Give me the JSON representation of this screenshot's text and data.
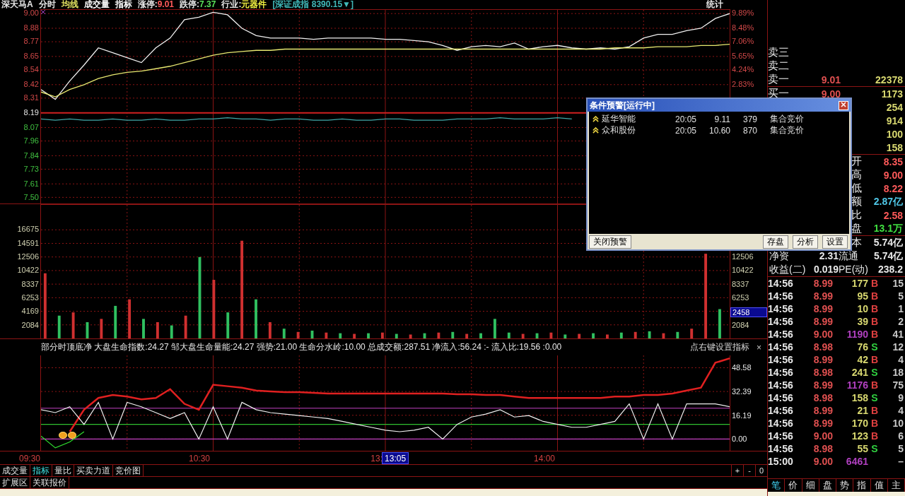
{
  "header": {
    "stock": "深天马A",
    "items": [
      {
        "text": "分时",
        "color": "#e8e8e8"
      },
      {
        "text": "均线",
        "color": "#e0e060"
      },
      {
        "text": "成交量",
        "color": "#ffffff"
      },
      {
        "text": "指标",
        "color": "#ffffff"
      }
    ],
    "fields": [
      {
        "label": "涨停:",
        "value": "9.01",
        "color": "#ff5a5a"
      },
      {
        "label": "跌停:",
        "value": "7.37",
        "color": "#5ae05a"
      },
      {
        "label": "行业:",
        "value": "元器件",
        "color": "#f0f040"
      }
    ],
    "index": "[深证成指 8390.15▼]",
    "stats_button": "统计"
  },
  "price_chart": {
    "right_labels": [
      "9.89%",
      "8.48%",
      "7.06%",
      "5.65%",
      "4.24%",
      "2.83%"
    ],
    "chart_data": {
      "type": "line",
      "ylim": [
        7.45,
        9.03
      ],
      "grid": true,
      "yticks": [
        {
          "value": 9,
          "label": "9.00"
        },
        {
          "value": 8.88,
          "label": "8.88"
        },
        {
          "value": 8.77,
          "label": "8.77"
        },
        {
          "value": 8.65,
          "label": "8.65"
        },
        {
          "value": 8.54,
          "label": "8.54"
        },
        {
          "value": 8.42,
          "label": "8.42"
        },
        {
          "value": 8.31,
          "label": "8.31"
        },
        {
          "value": 8.19,
          "label": "8.19"
        },
        {
          "value": 8.07,
          "label": "8.07"
        },
        {
          "value": 7.96,
          "label": "7.96"
        },
        {
          "value": 7.84,
          "label": "7.84"
        },
        {
          "value": 7.73,
          "label": "7.73"
        },
        {
          "value": 7.61,
          "label": "7.61"
        },
        {
          "value": 7.5,
          "label": "7.50"
        }
      ],
      "series": [
        {
          "color": "#f0f0f0",
          "values": [
            8.38,
            8.3,
            8.45,
            8.58,
            8.72,
            8.68,
            8.64,
            8.6,
            8.72,
            8.8,
            8.95,
            8.97,
            9.01,
            8.99,
            8.88,
            8.82,
            8.8,
            8.8,
            8.8,
            8.79,
            8.8,
            8.8,
            8.8,
            8.8,
            8.79,
            8.79,
            8.78,
            8.77,
            8.74,
            8.7,
            8.73,
            8.74,
            8.73,
            8.76,
            8.71,
            8.73,
            8.74,
            8.72,
            8.71,
            8.72,
            8.71,
            8.73,
            8.8,
            8.83,
            8.83,
            8.86,
            8.88,
            8.96,
            9.0
          ]
        },
        {
          "color": "#e8e870",
          "values": [
            8.36,
            8.32,
            8.38,
            8.42,
            8.47,
            8.5,
            8.52,
            8.53,
            8.55,
            8.57,
            8.6,
            8.63,
            8.66,
            8.68,
            8.69,
            8.7,
            8.7,
            8.71,
            8.71,
            8.71,
            8.71,
            8.71,
            8.71,
            8.71,
            8.71,
            8.71,
            8.71,
            8.71,
            8.71,
            8.71,
            8.71,
            8.71,
            8.71,
            8.71,
            8.71,
            8.71,
            8.71,
            8.71,
            8.71,
            8.71,
            8.72,
            8.72,
            8.72,
            8.73,
            8.73,
            8.73,
            8.74,
            8.74,
            8.75
          ]
        },
        {
          "color": "#40a8a8",
          "values": [
            8.14,
            8.13,
            8.14,
            8.13,
            8.13,
            8.14,
            8.13,
            8.13,
            8.14,
            8.13,
            8.13,
            8.14,
            8.14,
            8.15,
            8.14,
            8.14,
            8.13,
            8.14,
            8.14,
            8.13,
            8.13,
            8.14,
            8.13,
            8.13,
            8.14,
            8.14,
            8.13,
            8.13,
            8.13,
            8.14,
            8.14,
            8.14,
            8.15,
            8.14,
            8.14,
            8.14,
            8.15,
            8.14,
            null,
            null,
            null,
            null,
            null,
            null,
            null,
            null,
            null,
            null,
            null
          ]
        },
        {
          "color": "#d02020",
          "values": [
            8.19,
            8.19,
            8.19,
            8.19,
            8.19,
            8.19,
            8.19,
            8.19,
            8.19,
            8.19,
            8.19,
            8.19,
            8.19,
            8.19,
            8.19,
            8.19,
            8.19,
            8.19,
            8.19,
            8.19,
            8.19,
            8.19,
            8.19,
            8.19,
            8.19,
            8.19,
            8.19,
            8.19,
            8.19,
            8.19,
            8.19,
            8.19,
            8.19,
            8.19,
            8.19,
            8.19,
            8.19,
            8.19,
            8.19,
            null,
            null,
            null,
            null,
            null,
            null,
            null,
            null,
            null,
            null
          ]
        }
      ]
    }
  },
  "volume_chart": {
    "right_labels": [
      "12506",
      "10422",
      "8337",
      "6253",
      "2084"
    ],
    "cursor_value": "2458",
    "chart_data": {
      "type": "bar",
      "ylim": [
        0,
        20500
      ],
      "grid": true,
      "yticks": [
        16675,
        14591,
        12506,
        10422,
        8337,
        6253,
        4169,
        2084
      ],
      "series": [
        {
          "color": "#d03030",
          "values": [
            10000,
            null,
            4000,
            null,
            3000,
            null,
            6000,
            null,
            2500,
            null,
            3500,
            null,
            9000,
            null,
            15000,
            null,
            2500,
            null,
            1000,
            null,
            900,
            null,
            700,
            null,
            900,
            null,
            600,
            null,
            900,
            null,
            700,
            null,
            null,
            null,
            700,
            null,
            900,
            null,
            700,
            null,
            600,
            null,
            1000,
            null,
            800,
            null,
            1500,
            13000,
            null
          ]
        },
        {
          "color": "#30c060",
          "values": [
            null,
            3500,
            null,
            2500,
            null,
            5000,
            null,
            3000,
            null,
            2000,
            null,
            12500,
            null,
            4000,
            null,
            6000,
            null,
            1500,
            null,
            1200,
            null,
            800,
            null,
            800,
            null,
            700,
            null,
            800,
            null,
            1000,
            null,
            800,
            3000,
            900,
            null,
            800,
            null,
            600,
            null,
            800,
            null,
            900,
            null,
            1100,
            null,
            1000,
            null,
            null,
            4500
          ]
        }
      ]
    }
  },
  "indicator": {
    "legend": "部分时顶底净  大盘生命指数:24.27  邹大盘生命量能:24.27  强势:21.00  生命分水岭:10.00  总成交额:287.51  净流入:56.24  :-  流入比:19.56  :0.00",
    "hint": "点右键设置指标",
    "close": "×",
    "chart_data": {
      "type": "line",
      "ylim": [
        -8,
        57
      ],
      "grid": true,
      "yticks": [
        {
          "value": 48.58,
          "label": "48.58"
        },
        {
          "value": 32.39,
          "label": "32.39"
        },
        {
          "value": 16.19,
          "label": "16.19"
        },
        {
          "value": 0,
          "label": "0.00"
        }
      ],
      "series": [
        {
          "color": "#c040c0",
          "values": [
            21,
            21,
            21,
            21,
            21,
            21,
            21,
            21,
            21,
            21,
            21,
            21,
            21,
            21,
            21,
            21,
            21,
            21,
            21,
            21,
            21,
            21,
            21,
            21,
            21,
            21,
            21,
            21,
            21,
            21,
            21,
            21,
            21,
            21,
            21,
            21,
            21,
            21,
            21,
            21,
            21,
            21,
            21,
            21,
            21,
            21,
            21,
            21,
            21
          ]
        },
        {
          "color": "#30c030",
          "values": [
            10,
            10,
            10,
            10,
            10,
            10,
            10,
            10,
            10,
            10,
            10,
            10,
            10,
            10,
            10,
            10,
            10,
            10,
            10,
            10,
            10,
            10,
            10,
            10,
            10,
            10,
            10,
            10,
            10,
            10,
            10,
            10,
            10,
            10,
            10,
            10,
            10,
            10,
            10,
            10,
            10,
            10,
            10,
            10,
            10,
            10,
            10,
            10,
            10
          ]
        },
        {
          "color": "#c040c0",
          "values": [
            0,
            0,
            0,
            0,
            0,
            0,
            0,
            0,
            0,
            0,
            0,
            0,
            0,
            0,
            0,
            0,
            0,
            0,
            0,
            0,
            0,
            0,
            0,
            0,
            0,
            0,
            0,
            0,
            0,
            0,
            0,
            0,
            0,
            0,
            0,
            0,
            0,
            0,
            0,
            0,
            0,
            0,
            0,
            0,
            0,
            0,
            0,
            0,
            0
          ]
        },
        {
          "color": "#e02020",
          "values": [
            null,
            null,
            5,
            20,
            28,
            30,
            29,
            27,
            28,
            34,
            24,
            20,
            37,
            36,
            35,
            33,
            32.5,
            32,
            32,
            31.5,
            31,
            31,
            31,
            31,
            31,
            31,
            31,
            31,
            31,
            30.5,
            30.5,
            30,
            30,
            29,
            28,
            28,
            28,
            28,
            28,
            28,
            29,
            29,
            30,
            30,
            31,
            33,
            35,
            52,
            55
          ]
        },
        {
          "color": "#30e030",
          "values": [
            2,
            -6,
            -2,
            5,
            null,
            null,
            null,
            null,
            null,
            null,
            null,
            null,
            null,
            null,
            null,
            null,
            null,
            null,
            null,
            null,
            null,
            null,
            null,
            null,
            null,
            null,
            null,
            null,
            null,
            null,
            null,
            null,
            null,
            null,
            null,
            null,
            null,
            null,
            null,
            null,
            null,
            null,
            null,
            null,
            null,
            null,
            null,
            null,
            null
          ]
        },
        {
          "color": "#f0f0f0",
          "values": [
            20,
            18,
            22,
            10,
            25,
            0,
            25,
            22,
            18,
            14,
            18,
            0,
            22,
            0,
            25,
            20,
            18,
            17,
            16,
            15,
            14,
            12,
            10,
            8,
            6,
            5,
            6,
            8,
            0,
            10,
            15,
            17,
            20,
            15,
            16,
            12,
            10,
            8,
            8,
            10,
            12,
            24,
            0,
            24,
            0,
            24,
            24,
            24,
            22
          ]
        }
      ]
    }
  },
  "time_axis": {
    "labels": [
      "09:30",
      "10:30",
      "13:",
      "14:00"
    ],
    "cursor": "13:05"
  },
  "bottom_tabs": [
    {
      "label": "成交量",
      "selected": false
    },
    {
      "label": "指标",
      "selected": true
    },
    {
      "label": "量比",
      "selected": false
    },
    {
      "label": "买卖力道",
      "selected": false
    },
    {
      "label": "竞价图",
      "selected": false
    }
  ],
  "zoom_buttons": [
    "+",
    "-",
    "0"
  ],
  "extra_tabs": [
    {
      "label": "扩展区",
      "selected": false
    },
    {
      "label": "关联报价",
      "selected": false
    }
  ],
  "quote": {
    "asks": [
      {
        "label": "卖三"
      },
      {
        "label": "卖二"
      },
      {
        "label": "卖一",
        "price": "9.01",
        "volume": "22378"
      }
    ],
    "bids": [
      {
        "label": "买一",
        "price": "9.00",
        "volume": "1173"
      },
      {
        "volume": "254"
      },
      {
        "volume": "914"
      },
      {
        "volume": "100"
      },
      {
        "volume": "158"
      }
    ]
  },
  "stats": [
    {
      "label": "开",
      "value": "8.35",
      "color": "#ff5a5a"
    },
    {
      "label": "高",
      "value": "9.00",
      "color": "#ff5a5a"
    },
    {
      "label": "低",
      "value": "8.22",
      "color": "#ff5a5a"
    },
    {
      "label": "额",
      "value": "2.87亿",
      "color": "#50c8e8"
    },
    {
      "label": "比",
      "value": "2.58",
      "color": "#ff5a5a"
    },
    {
      "label": "盘",
      "value": "13.1万",
      "color": "#40e040"
    }
  ],
  "fundamentals": [
    {
      "cells": [
        "本",
        "5.74亿"
      ]
    },
    {
      "cells": [
        "净资",
        "2.31",
        "流通",
        "5.74亿"
      ]
    },
    {
      "cells": [
        "收益(二)",
        "0.019",
        "PE(动)",
        "238.2"
      ]
    }
  ],
  "trades": [
    {
      "time": "14:56",
      "price": "8.99",
      "volume": "177",
      "side": "B",
      "count": "15",
      "kind": "buy",
      "large": false
    },
    {
      "time": "14:56",
      "price": "8.99",
      "volume": "95",
      "side": "B",
      "count": "5",
      "kind": "buy",
      "large": false
    },
    {
      "time": "14:56",
      "price": "8.99",
      "volume": "10",
      "side": "B",
      "count": "1",
      "kind": "buy",
      "large": false
    },
    {
      "time": "14:56",
      "price": "8.99",
      "volume": "39",
      "side": "B",
      "count": "2",
      "kind": "buy",
      "large": false
    },
    {
      "time": "14:56",
      "price": "9.00",
      "volume": "1190",
      "side": "B",
      "count": "41",
      "kind": "buy",
      "large": true
    },
    {
      "time": "14:56",
      "price": "8.98",
      "volume": "76",
      "side": "S",
      "count": "12",
      "kind": "sell",
      "large": false
    },
    {
      "time": "14:56",
      "price": "8.99",
      "volume": "42",
      "side": "B",
      "count": "4",
      "kind": "buy",
      "large": false
    },
    {
      "time": "14:56",
      "price": "8.98",
      "volume": "241",
      "side": "S",
      "count": "18",
      "kind": "sell",
      "large": false
    },
    {
      "time": "14:56",
      "price": "8.99",
      "volume": "1176",
      "side": "B",
      "count": "75",
      "kind": "buy",
      "large": true
    },
    {
      "time": "14:56",
      "price": "8.98",
      "volume": "158",
      "side": "S",
      "count": "9",
      "kind": "sell",
      "large": false
    },
    {
      "time": "14:56",
      "price": "8.99",
      "volume": "21",
      "side": "B",
      "count": "4",
      "kind": "buy",
      "large": false
    },
    {
      "time": "14:56",
      "price": "8.99",
      "volume": "170",
      "side": "B",
      "count": "10",
      "kind": "buy",
      "large": false
    },
    {
      "time": "14:56",
      "price": "9.00",
      "volume": "123",
      "side": "B",
      "count": "6",
      "kind": "buy",
      "large": false
    },
    {
      "time": "14:56",
      "price": "8.98",
      "volume": "55",
      "side": "S",
      "count": "5",
      "kind": "sell",
      "large": false
    },
    {
      "time": "15:00",
      "price": "9.00",
      "volume": "6461",
      "count": "–",
      "kind": "close",
      "large": true
    }
  ],
  "panel_tabs": [
    {
      "label": "笔",
      "selected": true
    },
    {
      "label": "价",
      "selected": false
    },
    {
      "label": "细",
      "selected": false
    },
    {
      "label": "盘",
      "selected": false
    },
    {
      "label": "势",
      "selected": false
    },
    {
      "label": "指",
      "selected": false
    },
    {
      "label": "值",
      "selected": false
    },
    {
      "label": "主",
      "selected": false
    }
  ],
  "alert_dialog": {
    "title": "条件预警[运行中]",
    "rows": [
      {
        "name": "延华智能",
        "time": "20:05",
        "price": "9.11",
        "volume": "379",
        "type": "集合竞价"
      },
      {
        "name": "众和股份",
        "time": "20:05",
        "price": "10.60",
        "volume": "870",
        "type": "集合竞价"
      }
    ],
    "left_button": "关闭预警",
    "buttons": [
      "存盘",
      "分析",
      "设置"
    ]
  }
}
